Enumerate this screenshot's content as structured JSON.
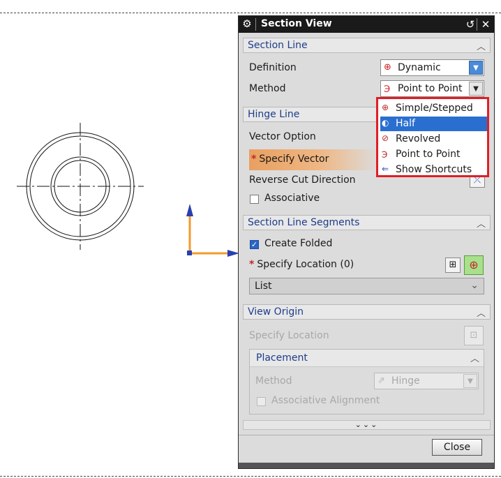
{
  "dialog": {
    "title": "Section View",
    "close_label": "Close"
  },
  "section_line": {
    "header": "Section Line",
    "definition_label": "Definition",
    "definition_value": "Dynamic",
    "method_label": "Method",
    "method_value": "Point to Point"
  },
  "method_menu": {
    "items": [
      {
        "label": "Simple/Stepped",
        "icon": "simple-stepped-icon"
      },
      {
        "label": "Half",
        "icon": "half-icon",
        "selected": true
      },
      {
        "label": "Revolved",
        "icon": "revolved-icon"
      },
      {
        "label": "Point to Point",
        "icon": "point-to-point-icon"
      },
      {
        "label": "Show Shortcuts",
        "icon": "show-shortcuts-icon"
      }
    ]
  },
  "hinge_line": {
    "header": "Hinge Line",
    "vector_option_label": "Vector Option",
    "specify_vector_label": "Specify Vector",
    "reverse_cut_label": "Reverse Cut Direction",
    "associative_label": "Associative",
    "associative_checked": false
  },
  "segments": {
    "header": "Section Line Segments",
    "create_folded_label": "Create Folded",
    "create_folded_checked": true,
    "specify_location_label": "Specify Location (0)",
    "list_label": "List"
  },
  "view_origin": {
    "header": "View Origin",
    "specify_location_label": "Specify Location",
    "placement_header": "Placement",
    "method_label": "Method",
    "method_value": "Hinge",
    "associative_alignment_label": "Associative Alignment"
  },
  "required_marker": "*",
  "colors": {
    "title_bar": "#1a1a1a",
    "group_header_text": "#1c3d8a",
    "highlight": "#e01e26",
    "selection": "#2a6fd0",
    "specify_vector_bg": "#e8a060"
  }
}
